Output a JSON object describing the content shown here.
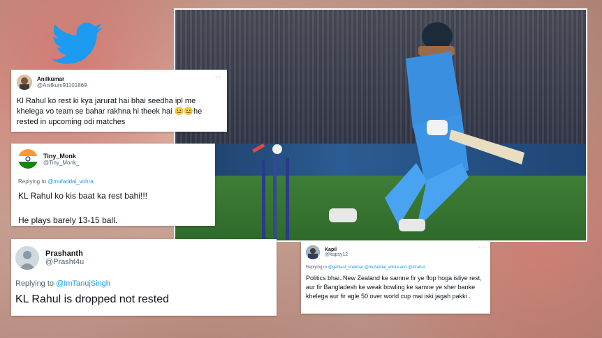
{
  "brand": {
    "logo_icon": "twitter-bird-icon",
    "color": "#1d9bf0"
  },
  "photo": {
    "description_icon": "cricket-photo"
  },
  "tweets": [
    {
      "name": "Anilkumar",
      "handle": "@Anilkum91101869",
      "text": "Kl Rahul ko rest ki kya jarurat hai bhai seedha ipl me khelega vo team se bahar rakhna hi theek hai 😐😐he rested in upcoming odi matches"
    },
    {
      "name": "Tiny_Monk",
      "handle": "@Tiny_Monk_",
      "reply_prefix": "Replying to ",
      "reply_to": "@mufaddal_vohra",
      "text": "KL Rahul ko kis baat ka rest bahi!!!",
      "text2": "He plays barely 13-15 ball."
    },
    {
      "name": "Prashanth",
      "handle": "@Prasht4u",
      "reply_prefix": "Replying to ",
      "reply_to": "@ImTanujSingh",
      "text": "KL Rahul is dropped not rested"
    },
    {
      "name": "Kapil",
      "handle": "@kapsy12",
      "reply_prefix": "Replying to ",
      "reply_to": "@gehlaut_shekhar @mufaddal_vohra and @klrahul",
      "text": "Politics bhai..New Zealand ke samne fir ye flop hoga isliye rest, aur fir Bangladesh ke weak bowling ke samne ye sher banke khelega aur fir agle 50 over world cup mai iski jagah pakki ."
    }
  ],
  "more_label": "···"
}
